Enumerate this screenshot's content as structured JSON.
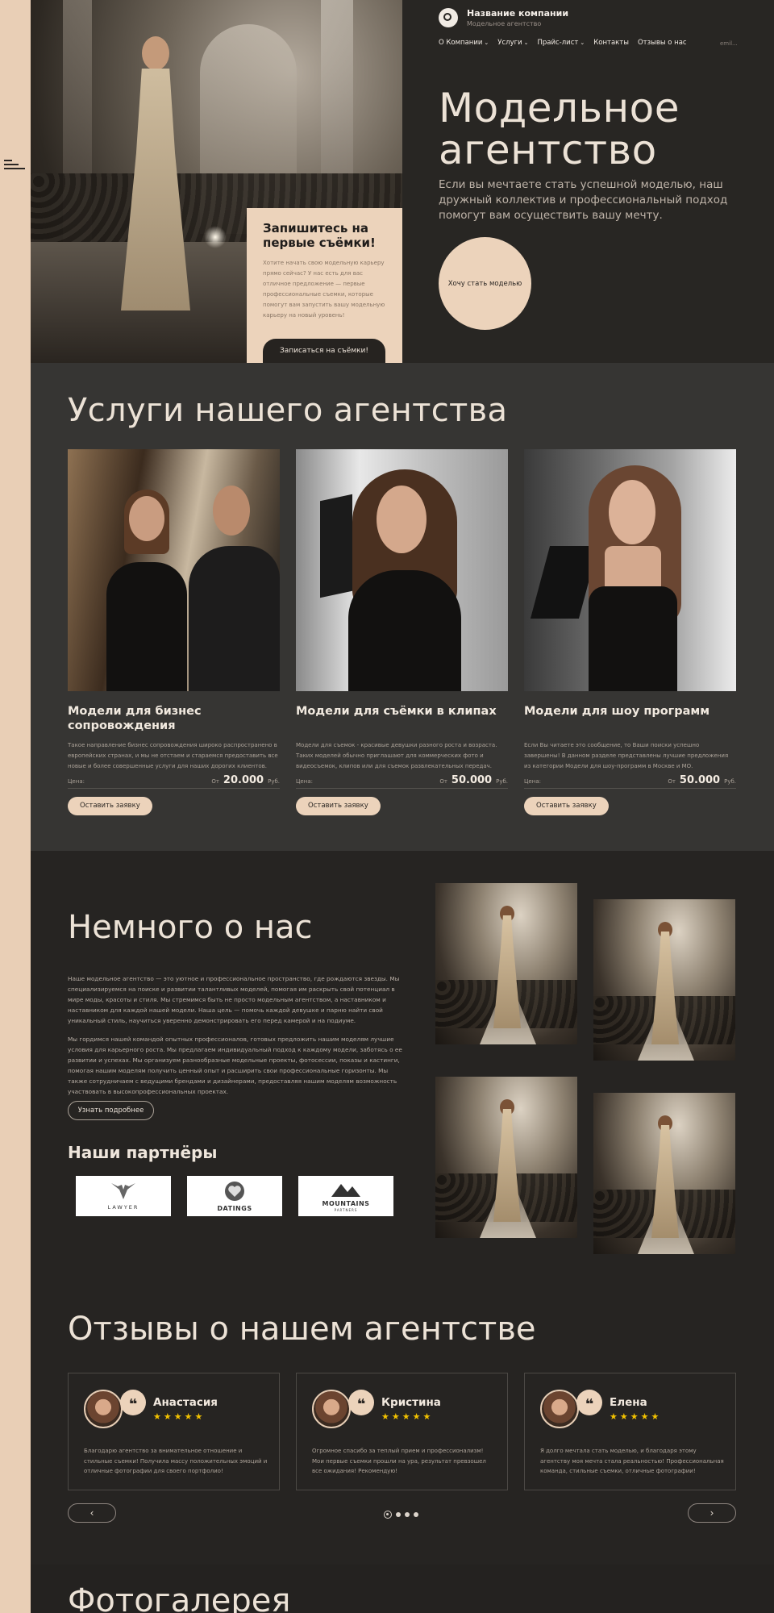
{
  "header": {
    "company_name": "Название компании",
    "company_sub": "Модельное агентство",
    "nav": [
      {
        "label": "О Компании",
        "dropdown": true
      },
      {
        "label": "Услуги",
        "dropdown": true
      },
      {
        "label": "Прайс-лист",
        "dropdown": true
      },
      {
        "label": "Контакты",
        "dropdown": false
      },
      {
        "label": "Отзывы о нас",
        "dropdown": false
      }
    ],
    "email": "emil..."
  },
  "hero": {
    "title_line1": "Модельное",
    "title_line2": "агентство",
    "description": "Если вы мечтаете стать успешной моделью, наш дружный коллектив и профессиональный подход помогут вам осуществить вашу мечту.",
    "cta_label": "Хочу стать моделью",
    "card": {
      "title": "Запишитесь на первые съёмки!",
      "text": "Хотите начать свою модельную карьеру прямо сейчас? У нас есть для вас отличное предложение — первые профессиональные съемки, которые помогут вам запустить вашу модельную карьеру на новый уровень!",
      "button": "Записаться на съёмки!"
    }
  },
  "services": {
    "title": "Услуги нашего агентства",
    "price_label": "Цена:",
    "price_from": "От",
    "currency": "Руб.",
    "request_label": "Оставить заявку",
    "items": [
      {
        "title": "Модели для бизнес сопровождения",
        "text": "Такое направление бизнес сопровождения широко распространено в европейских странах, и мы не отстаем и стараемся предоставить все новые и более совершенные услуги для наших дорогих клиентов.",
        "price": "20.000"
      },
      {
        "title": "Модели для съёмки в клипах",
        "text": "Модели для съемок - красивые девушки разного роста и возраста. Таких моделей обычно приглашают для коммерческих фото и видеосъемок, клипов или для съемок развлекательных передач.",
        "price": "50.000"
      },
      {
        "title": "Модели для шоу программ",
        "text": "Если Вы читаете это сообщение, то Ваши поиски успешно завершены! В данном разделе представлены лучшие предложения из категории Модели для шоу-программ в Москве и МО.",
        "price": "50.000"
      }
    ]
  },
  "about": {
    "title": "Немного о нас",
    "p1": "Наше модельное агентство — это уютное и профессиональное пространство, где рождаются звезды. Мы специализируемся на поиске и развитии талантливых моделей, помогая им раскрыть свой потенциал в мире моды, красоты и стиля. Мы стремимся быть не просто модельным агентством, а наставником и наставником для каждой нашей модели. Наша цель — помочь каждой девушке и парню найти свой уникальный стиль, научиться уверенно демонстрировать его перед камерой и на подиуме.",
    "p2": "Мы гордимся нашей командой опытных профессионалов, готовых предложить нашим моделям лучшие условия для карьерного роста. Мы предлагаем индивидуальный подход к каждому модели, заботясь о ее развитии и успехах. Мы организуем разнообразные модельные проекты, фотосессии, показы и кастинги, помогая нашим моделям получить ценный опыт и расширить свои профессиональные горизонты. Мы также сотрудничаем с ведущими брендами и дизайнерами, предоставляя нашим моделям возможность участвовать в высокопрофессиональных проектах.",
    "more_label": "Узнать подробнее",
    "partners_title": "Наши партнёры",
    "partners": [
      "LAWYER",
      "DATINGS",
      "MOUNTAINS"
    ],
    "partners_sub": [
      "",
      "",
      "PARTNERS"
    ]
  },
  "reviews": {
    "title": "Отзывы о нашем агентстве",
    "quote_glyph": "❝",
    "stars": "★★★★★",
    "prev": "‹",
    "next": "›",
    "items": [
      {
        "name": "Анастасия",
        "text": "Благодарю агентство за внимательное отношение и стильные съемки! Получила массу положительных эмоций и отличные фотографии для своего портфолио!"
      },
      {
        "name": "Кристина",
        "text": "Огромное спасибо за теплый прием и профессионализм! Мои первые съемки прошли на ура, результат превзошел все ожидания! Рекомендую!"
      },
      {
        "name": "Елена",
        "text": "Я долго мечтала стать моделью, и благодаря этому агентству моя мечта стала реальностью! Профессиональная команда, стильные съемки, отличные фотографии!"
      }
    ]
  },
  "gallery": {
    "title": "Фотогалерея"
  },
  "colors": {
    "accent": "#ecd3bb",
    "dark": "#262422",
    "section": "#363533",
    "stars": "#f2c200"
  }
}
